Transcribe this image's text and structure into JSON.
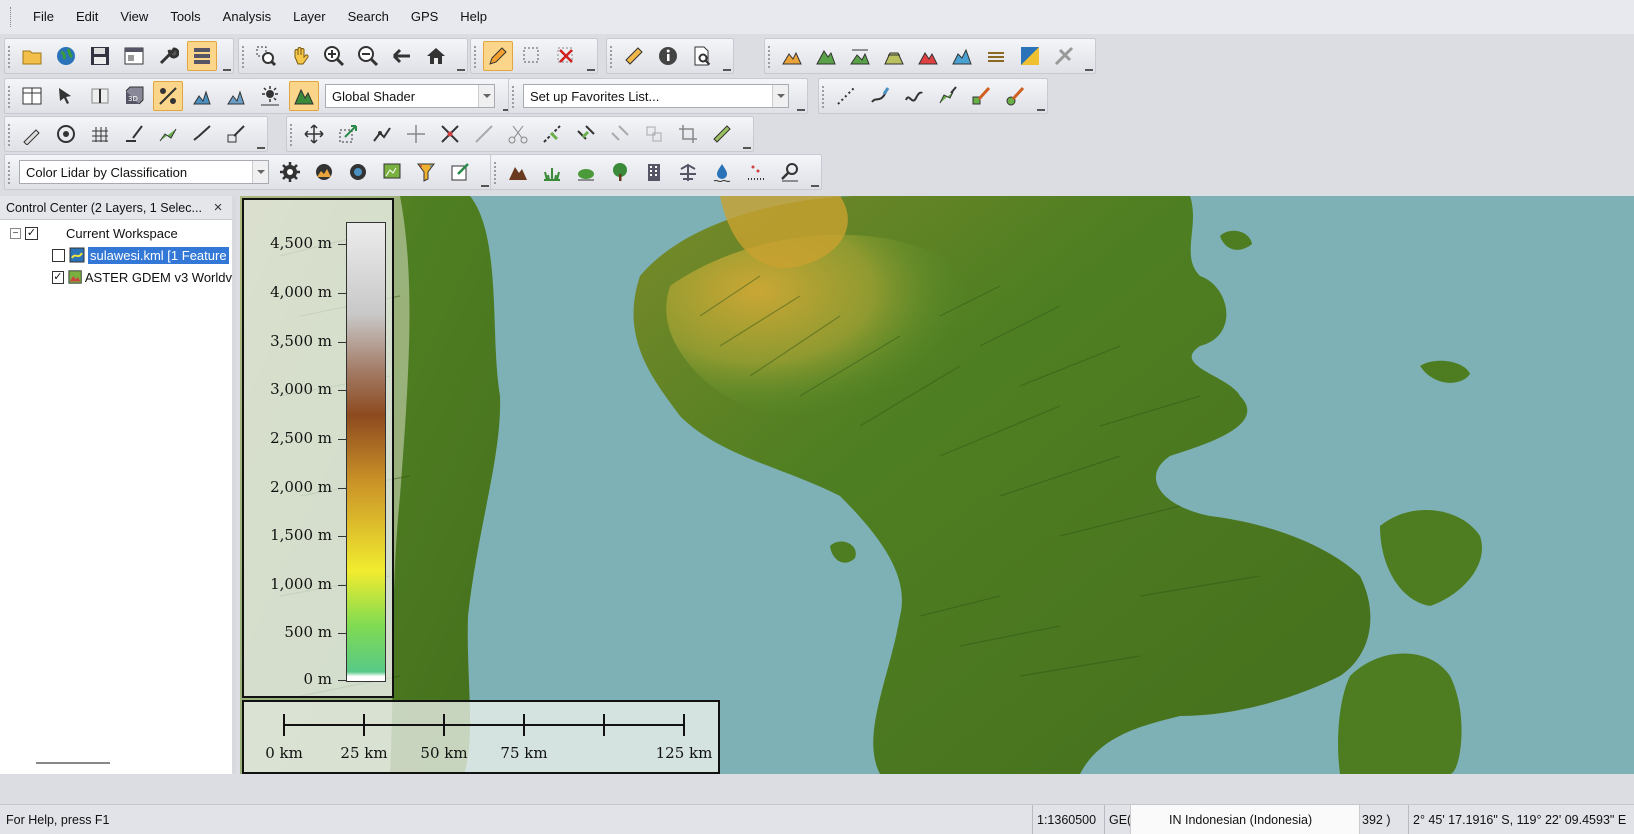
{
  "menu": [
    "File",
    "Edit",
    "View",
    "Tools",
    "Analysis",
    "Layer",
    "Search",
    "GPS",
    "Help"
  ],
  "toolbars": {
    "shader_select": "Global Shader",
    "favorites_select": "Set up Favorites List...",
    "lidar_select": "Color Lidar by Classification"
  },
  "control_center": {
    "title": "Control Center (2 Layers, 1 Selec...",
    "close": "×",
    "workspace": "Current Workspace",
    "layers": [
      {
        "label": "sulawesi.kml [1 Feature",
        "checked": false,
        "selected": true
      },
      {
        "label": "ASTER GDEM v3 Worldv",
        "checked": true,
        "selected": false
      }
    ]
  },
  "legend": {
    "labels": [
      "4,500 m",
      "4,000 m",
      "3,500 m",
      "3,000 m",
      "2,500 m",
      "2,000 m",
      "1,500 m",
      "1,000 m",
      "500 m",
      "0 m"
    ]
  },
  "scale": {
    "labels": [
      "0 km",
      "25 km",
      "50 km",
      "75 km",
      "125 km"
    ]
  },
  "status": {
    "help": "For Help, press F1",
    "scale": "1:1360500",
    "projection": "GE(",
    "language": "IN  Indonesian (Indonesia)",
    "partial": "392 )",
    "coords": "2° 45' 17.1916\" S, 119° 22' 09.4593\" E"
  },
  "colors": {
    "sea": "#7eb1b5",
    "lowland": "#4a7a1e",
    "highland": "#c9a830",
    "selection": "#3378d6"
  }
}
